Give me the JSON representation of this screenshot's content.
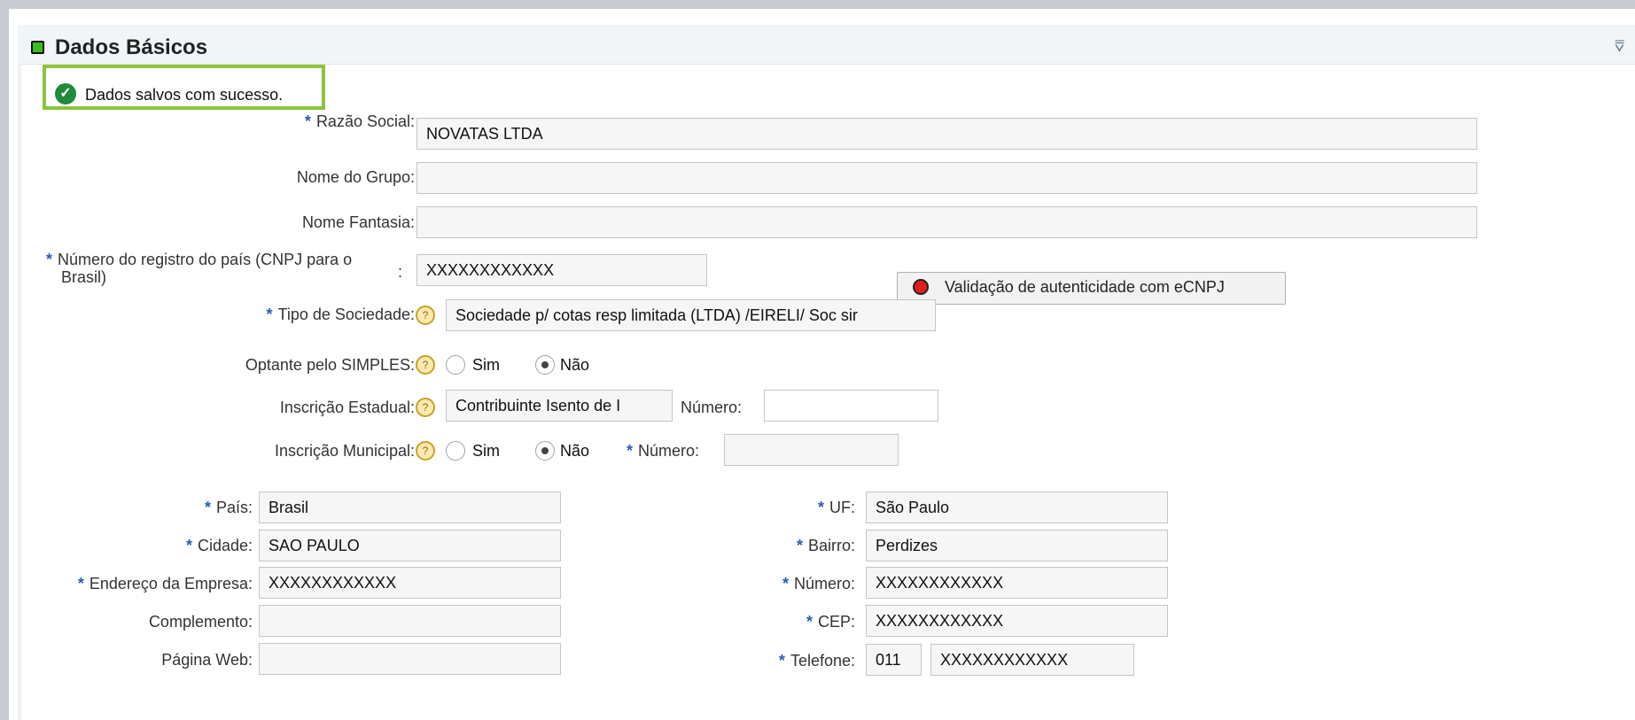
{
  "section": {
    "title": "Dados Básicos"
  },
  "message": {
    "text": "Dados salvos com sucesso."
  },
  "icons": {
    "section_status": "green-square-icon",
    "collapse": "collapse-icon",
    "success": "check-circle-icon",
    "help": "help-icon",
    "validation": "red-dot-icon"
  },
  "labels": {
    "razao_social": "Razão Social:",
    "nome_grupo": "Nome do Grupo:",
    "nome_fantasia": "Nome Fantasia:",
    "numero_registro_line1": "Número do registro do país (CNPJ para o",
    "numero_registro_line2": "Brasil)",
    "numero_registro_colon": ":",
    "tipo_sociedade": "Tipo de Sociedade:",
    "optante_simples": "Optante pelo SIMPLES:",
    "inscricao_estadual": "Inscrição Estadual:",
    "inscricao_estadual_numero": "Número:",
    "inscricao_municipal": "Inscrição Municipal:",
    "inscricao_municipal_numero": "Número:",
    "pais": "País:",
    "cidade": "Cidade:",
    "endereco": "Endereço da Empresa:",
    "complemento": "Complemento:",
    "pagina_web": "Página Web:",
    "uf": "UF:",
    "bairro": "Bairro:",
    "numero": "Número:",
    "cep": "CEP:",
    "telefone": "Telefone:"
  },
  "required_mark": "*",
  "values": {
    "razao_social": "NOVATAS LTDA",
    "nome_grupo": "",
    "nome_fantasia": "",
    "numero_registro": "XXXXXXXXXXXX",
    "tipo_sociedade": "Sociedade p/ cotas resp limitada (LTDA) /EIRELI/ Soc sir",
    "inscricao_estadual": "Contribuinte Isento de I",
    "inscricao_estadual_numero": "",
    "inscricao_municipal_numero": "",
    "pais": "Brasil",
    "cidade": "SAO PAULO",
    "endereco": "XXXXXXXXXXXX",
    "complemento": "",
    "pagina_web": "",
    "uf": "São Paulo",
    "bairro": "Perdizes",
    "numero": "XXXXXXXXXXXX",
    "cep": "XXXXXXXXXXXX",
    "telefone_ddd": "011",
    "telefone": "XXXXXXXXXXXX"
  },
  "radio_labels": {
    "sim": "Sim",
    "nao": "Não"
  },
  "radios": {
    "optante_simples": "Não",
    "inscricao_municipal": "Não"
  },
  "button": {
    "validacao": "Validação de autenticidade com eCNPJ"
  }
}
